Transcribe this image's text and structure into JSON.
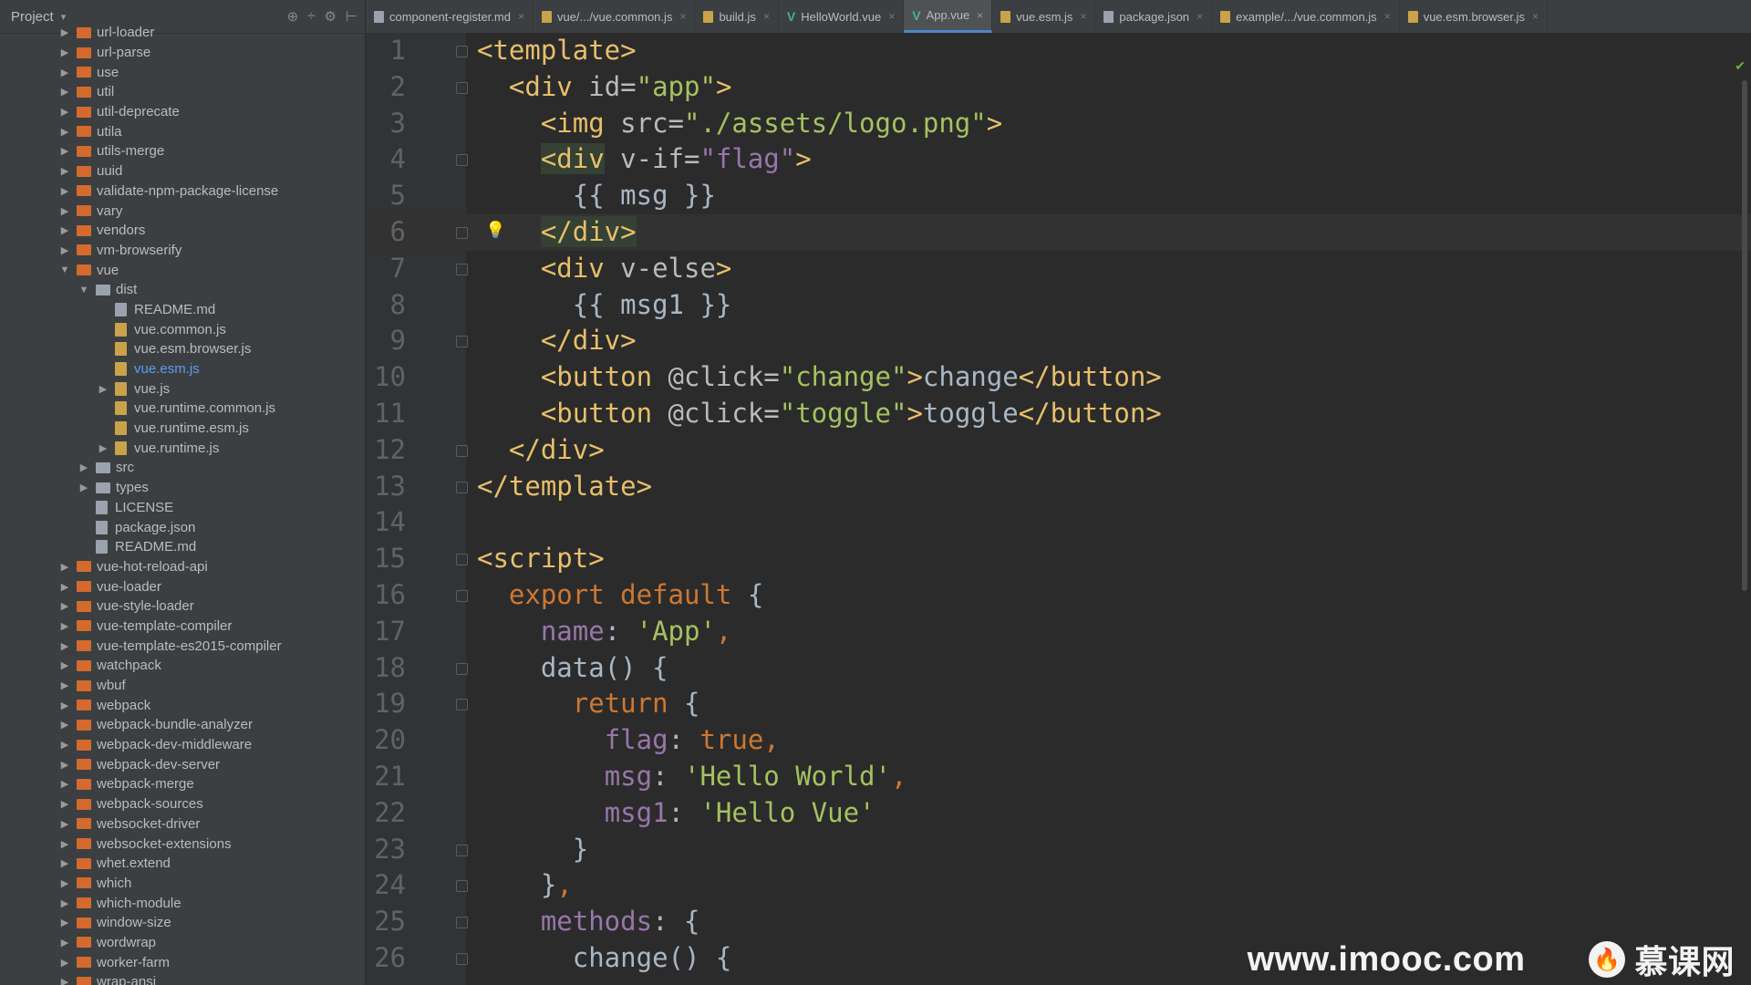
{
  "project_panel": {
    "title": "Project",
    "dropdown_glyph": "▾",
    "header_icons": [
      "⊕",
      "÷",
      "⚙",
      "⊢"
    ],
    "tree": [
      {
        "depth": 0,
        "kind": "folder",
        "color": "orange",
        "arrow": "▶",
        "label": "url-loader"
      },
      {
        "depth": 0,
        "kind": "folder",
        "color": "orange",
        "arrow": "▶",
        "label": "url-parse"
      },
      {
        "depth": 0,
        "kind": "folder",
        "color": "orange",
        "arrow": "▶",
        "label": "use"
      },
      {
        "depth": 0,
        "kind": "folder",
        "color": "orange",
        "arrow": "▶",
        "label": "util"
      },
      {
        "depth": 0,
        "kind": "folder",
        "color": "orange",
        "arrow": "▶",
        "label": "util-deprecate"
      },
      {
        "depth": 0,
        "kind": "folder",
        "color": "orange",
        "arrow": "▶",
        "label": "utila"
      },
      {
        "depth": 0,
        "kind": "folder",
        "color": "orange",
        "arrow": "▶",
        "label": "utils-merge"
      },
      {
        "depth": 0,
        "kind": "folder",
        "color": "orange",
        "arrow": "▶",
        "label": "uuid"
      },
      {
        "depth": 0,
        "kind": "folder",
        "color": "orange",
        "arrow": "▶",
        "label": "validate-npm-package-license"
      },
      {
        "depth": 0,
        "kind": "folder",
        "color": "orange",
        "arrow": "▶",
        "label": "vary"
      },
      {
        "depth": 0,
        "kind": "folder",
        "color": "orange",
        "arrow": "▶",
        "label": "vendors"
      },
      {
        "depth": 0,
        "kind": "folder",
        "color": "orange",
        "arrow": "▶",
        "label": "vm-browserify"
      },
      {
        "depth": 0,
        "kind": "folder",
        "color": "orange",
        "arrow": "▼",
        "label": "vue"
      },
      {
        "depth": 1,
        "kind": "folder",
        "color": "gray",
        "arrow": "▼",
        "label": "dist"
      },
      {
        "depth": 2,
        "kind": "doc",
        "arrow": "",
        "label": "README.md"
      },
      {
        "depth": 2,
        "kind": "js",
        "arrow": "",
        "label": "vue.common.js"
      },
      {
        "depth": 2,
        "kind": "js",
        "arrow": "",
        "label": "vue.esm.browser.js"
      },
      {
        "depth": 2,
        "kind": "js",
        "arrow": "",
        "label": "vue.esm.js",
        "selected": true
      },
      {
        "depth": 2,
        "kind": "js",
        "arrow": "▶",
        "label": "vue.js"
      },
      {
        "depth": 2,
        "kind": "js",
        "arrow": "",
        "label": "vue.runtime.common.js"
      },
      {
        "depth": 2,
        "kind": "js",
        "arrow": "",
        "label": "vue.runtime.esm.js"
      },
      {
        "depth": 2,
        "kind": "js",
        "arrow": "▶",
        "label": "vue.runtime.js"
      },
      {
        "depth": 1,
        "kind": "folder",
        "color": "gray",
        "arrow": "▶",
        "label": "src"
      },
      {
        "depth": 1,
        "kind": "folder",
        "color": "gray",
        "arrow": "▶",
        "label": "types"
      },
      {
        "depth": 1,
        "kind": "doc",
        "arrow": "",
        "label": "LICENSE"
      },
      {
        "depth": 1,
        "kind": "doc",
        "arrow": "",
        "label": "package.json"
      },
      {
        "depth": 1,
        "kind": "doc",
        "arrow": "",
        "label": "README.md"
      },
      {
        "depth": 0,
        "kind": "folder",
        "color": "orange",
        "arrow": "▶",
        "label": "vue-hot-reload-api"
      },
      {
        "depth": 0,
        "kind": "folder",
        "color": "orange",
        "arrow": "▶",
        "label": "vue-loader"
      },
      {
        "depth": 0,
        "kind": "folder",
        "color": "orange",
        "arrow": "▶",
        "label": "vue-style-loader"
      },
      {
        "depth": 0,
        "kind": "folder",
        "color": "orange",
        "arrow": "▶",
        "label": "vue-template-compiler"
      },
      {
        "depth": 0,
        "kind": "folder",
        "color": "orange",
        "arrow": "▶",
        "label": "vue-template-es2015-compiler"
      },
      {
        "depth": 0,
        "kind": "folder",
        "color": "orange",
        "arrow": "▶",
        "label": "watchpack"
      },
      {
        "depth": 0,
        "kind": "folder",
        "color": "orange",
        "arrow": "▶",
        "label": "wbuf"
      },
      {
        "depth": 0,
        "kind": "folder",
        "color": "orange",
        "arrow": "▶",
        "label": "webpack"
      },
      {
        "depth": 0,
        "kind": "folder",
        "color": "orange",
        "arrow": "▶",
        "label": "webpack-bundle-analyzer"
      },
      {
        "depth": 0,
        "kind": "folder",
        "color": "orange",
        "arrow": "▶",
        "label": "webpack-dev-middleware"
      },
      {
        "depth": 0,
        "kind": "folder",
        "color": "orange",
        "arrow": "▶",
        "label": "webpack-dev-server"
      },
      {
        "depth": 0,
        "kind": "folder",
        "color": "orange",
        "arrow": "▶",
        "label": "webpack-merge"
      },
      {
        "depth": 0,
        "kind": "folder",
        "color": "orange",
        "arrow": "▶",
        "label": "webpack-sources"
      },
      {
        "depth": 0,
        "kind": "folder",
        "color": "orange",
        "arrow": "▶",
        "label": "websocket-driver"
      },
      {
        "depth": 0,
        "kind": "folder",
        "color": "orange",
        "arrow": "▶",
        "label": "websocket-extensions"
      },
      {
        "depth": 0,
        "kind": "folder",
        "color": "orange",
        "arrow": "▶",
        "label": "whet.extend"
      },
      {
        "depth": 0,
        "kind": "folder",
        "color": "orange",
        "arrow": "▶",
        "label": "which"
      },
      {
        "depth": 0,
        "kind": "folder",
        "color": "orange",
        "arrow": "▶",
        "label": "which-module"
      },
      {
        "depth": 0,
        "kind": "folder",
        "color": "orange",
        "arrow": "▶",
        "label": "window-size"
      },
      {
        "depth": 0,
        "kind": "folder",
        "color": "orange",
        "arrow": "▶",
        "label": "wordwrap"
      },
      {
        "depth": 0,
        "kind": "folder",
        "color": "orange",
        "arrow": "▶",
        "label": "worker-farm"
      },
      {
        "depth": 0,
        "kind": "folder",
        "color": "orange",
        "arrow": "▶",
        "label": "wrap-ansi"
      }
    ]
  },
  "tabs": [
    {
      "label": "component-register.md",
      "icon": "doc"
    },
    {
      "label": "vue/.../vue.common.js",
      "icon": "js"
    },
    {
      "label": "build.js",
      "icon": "js"
    },
    {
      "label": "HelloWorld.vue",
      "icon": "vue"
    },
    {
      "label": "App.vue",
      "icon": "vue",
      "active": true
    },
    {
      "label": "vue.esm.js",
      "icon": "js"
    },
    {
      "label": "package.json",
      "icon": "doc"
    },
    {
      "label": "example/.../vue.common.js",
      "icon": "js"
    },
    {
      "label": "vue.esm.browser.js",
      "icon": "js"
    }
  ],
  "tab_close_glyph": "×",
  "editor": {
    "current_line": 6,
    "lines": [
      {
        "n": "1",
        "fold": true,
        "t": [
          [
            "c-tag",
            "<template>"
          ]
        ]
      },
      {
        "n": "2",
        "fold": true,
        "t": [
          [
            "",
            "  "
          ],
          [
            "c-tag",
            "<div "
          ],
          [
            "c-attr",
            "id="
          ],
          [
            "c-str",
            "\"app\""
          ],
          [
            "c-tag",
            ">"
          ]
        ]
      },
      {
        "n": "3",
        "fold": false,
        "t": [
          [
            "",
            "    "
          ],
          [
            "c-tag",
            "<img "
          ],
          [
            "c-attr",
            "src="
          ],
          [
            "c-str",
            "\"./assets/logo.png\""
          ],
          [
            "c-tag",
            ">"
          ]
        ]
      },
      {
        "n": "4",
        "fold": true,
        "t": [
          [
            "",
            "    "
          ],
          [
            "c-tag hl",
            "<div"
          ],
          [
            "c-tag",
            " "
          ],
          [
            "c-attr",
            "v-if="
          ],
          [
            "c-vattr",
            "\"flag\""
          ],
          [
            "c-tag",
            ">"
          ]
        ]
      },
      {
        "n": "5",
        "fold": false,
        "t": [
          [
            "",
            "      "
          ],
          [
            "c-text",
            "{{ msg }}"
          ]
        ]
      },
      {
        "n": "6",
        "fold": true,
        "t": [
          [
            "",
            "    "
          ],
          [
            "c-tag hl",
            "</div>"
          ]
        ]
      },
      {
        "n": "7",
        "fold": true,
        "t": [
          [
            "",
            "    "
          ],
          [
            "c-tag",
            "<div "
          ],
          [
            "c-attr",
            "v-else"
          ],
          [
            "c-tag",
            ">"
          ]
        ]
      },
      {
        "n": "8",
        "fold": false,
        "t": [
          [
            "",
            "      "
          ],
          [
            "c-text",
            "{{ msg1 }}"
          ]
        ]
      },
      {
        "n": "9",
        "fold": true,
        "t": [
          [
            "",
            "    "
          ],
          [
            "c-tag",
            "</div>"
          ]
        ]
      },
      {
        "n": "10",
        "fold": false,
        "t": [
          [
            "",
            "    "
          ],
          [
            "c-tag",
            "<button "
          ],
          [
            "c-attr",
            "@click="
          ],
          [
            "c-str",
            "\"change\""
          ],
          [
            "c-tag",
            ">"
          ],
          [
            "c-text",
            "change"
          ],
          [
            "c-tag",
            "</button>"
          ]
        ]
      },
      {
        "n": "11",
        "fold": false,
        "t": [
          [
            "",
            "    "
          ],
          [
            "c-tag",
            "<button "
          ],
          [
            "c-attr",
            "@click="
          ],
          [
            "c-str",
            "\"toggle\""
          ],
          [
            "c-tag",
            ">"
          ],
          [
            "c-text",
            "toggle"
          ],
          [
            "c-tag",
            "</button>"
          ]
        ]
      },
      {
        "n": "12",
        "fold": true,
        "t": [
          [
            "",
            "  "
          ],
          [
            "c-tag",
            "</div>"
          ]
        ]
      },
      {
        "n": "13",
        "fold": true,
        "t": [
          [
            "c-tag",
            "</template>"
          ]
        ]
      },
      {
        "n": "14",
        "fold": false,
        "t": []
      },
      {
        "n": "15",
        "fold": true,
        "t": [
          [
            "c-tag",
            "<script>"
          ]
        ]
      },
      {
        "n": "16",
        "fold": true,
        "t": [
          [
            "",
            "  "
          ],
          [
            "c-kw",
            "export default "
          ],
          [
            "c-punc",
            "{"
          ]
        ]
      },
      {
        "n": "17",
        "fold": false,
        "t": [
          [
            "",
            "    "
          ],
          [
            "c-prop",
            "name"
          ],
          [
            "c-punc",
            ": "
          ],
          [
            "c-str",
            "'App'"
          ],
          [
            "c-kw",
            ","
          ]
        ]
      },
      {
        "n": "18",
        "fold": true,
        "t": [
          [
            "",
            "    "
          ],
          [
            "c-text",
            "data"
          ],
          [
            "c-punc",
            "() {"
          ]
        ]
      },
      {
        "n": "19",
        "fold": true,
        "t": [
          [
            "",
            "      "
          ],
          [
            "c-kw",
            "return "
          ],
          [
            "c-punc",
            "{"
          ]
        ]
      },
      {
        "n": "20",
        "fold": false,
        "t": [
          [
            "",
            "        "
          ],
          [
            "c-prop",
            "flag"
          ],
          [
            "c-punc",
            ": "
          ],
          [
            "c-lit",
            "true"
          ],
          [
            "c-kw",
            ","
          ]
        ]
      },
      {
        "n": "21",
        "fold": false,
        "t": [
          [
            "",
            "        "
          ],
          [
            "c-prop",
            "msg"
          ],
          [
            "c-punc",
            ": "
          ],
          [
            "c-str",
            "'Hello World'"
          ],
          [
            "c-kw",
            ","
          ]
        ]
      },
      {
        "n": "22",
        "fold": false,
        "t": [
          [
            "",
            "        "
          ],
          [
            "c-prop",
            "msg1"
          ],
          [
            "c-punc",
            ": "
          ],
          [
            "c-str",
            "'Hello Vue'"
          ]
        ]
      },
      {
        "n": "23",
        "fold": true,
        "t": [
          [
            "",
            "      "
          ],
          [
            "c-punc",
            "}"
          ]
        ]
      },
      {
        "n": "24",
        "fold": true,
        "t": [
          [
            "",
            "    "
          ],
          [
            "c-punc",
            "}"
          ],
          [
            "c-kw",
            ","
          ]
        ]
      },
      {
        "n": "25",
        "fold": true,
        "t": [
          [
            "",
            "    "
          ],
          [
            "c-prop",
            "methods"
          ],
          [
            "c-punc",
            ": {"
          ]
        ]
      },
      {
        "n": "26",
        "fold": true,
        "t": [
          [
            "",
            "      "
          ],
          [
            "c-text",
            "change"
          ],
          [
            "c-punc",
            "() {"
          ]
        ]
      }
    ]
  },
  "watermark": {
    "url": "www.imooc.com",
    "brand": "慕课网",
    "flame_glyph": "🔥"
  },
  "colors": {
    "editor_bg": "#2b2b2b",
    "panel_bg": "#3c3f41",
    "tag": "#e8bf6a",
    "string": "#a5c261",
    "keyword": "#cc7832",
    "property": "#9876aa",
    "selected_file": "#589df6",
    "active_tab_underline": "#4a88c7"
  }
}
